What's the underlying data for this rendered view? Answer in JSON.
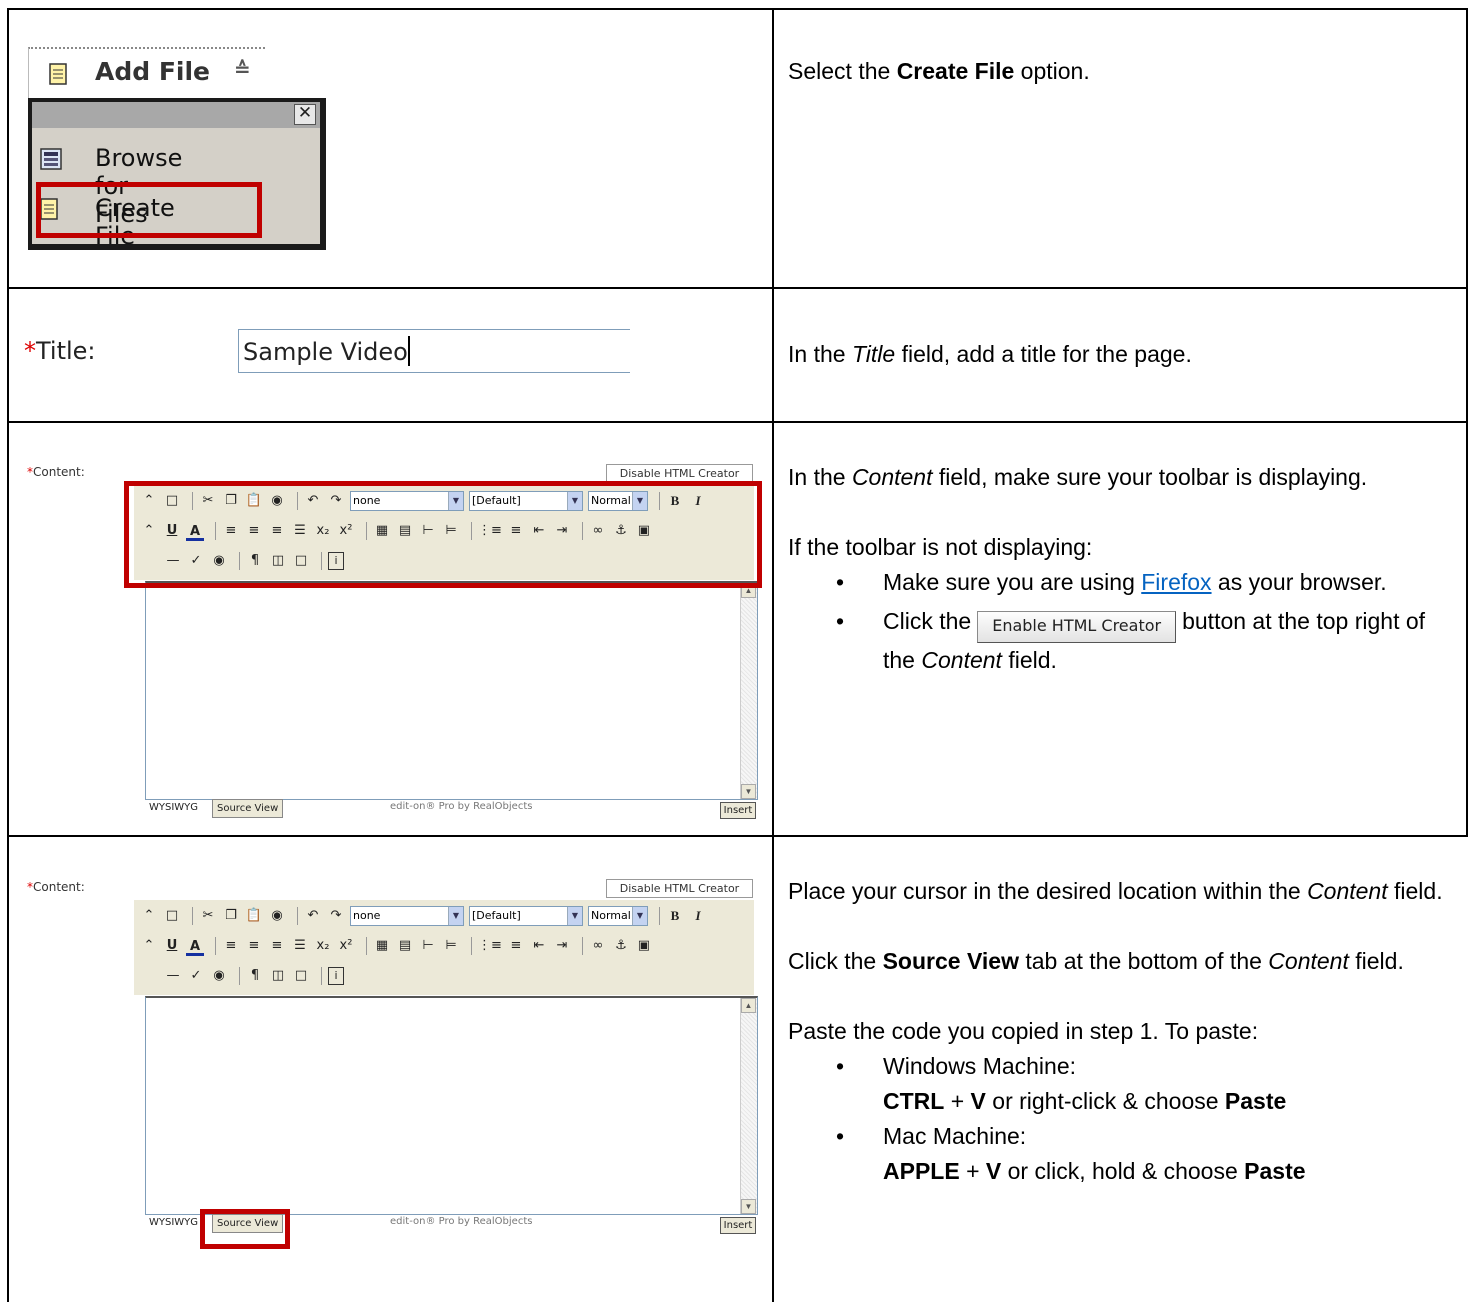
{
  "row1": {
    "addfile_label": "Add File",
    "menu_items": [
      "Browse for Files",
      "Create File"
    ],
    "instruction": {
      "pre": "Select the ",
      "bold": "Create File",
      "post": " option."
    }
  },
  "row2": {
    "required_mark": "*",
    "title_label": "Title:",
    "title_value": "Sample Video",
    "instruction": {
      "pre": "In the ",
      "italic": "Title",
      "post": " field, add a title for the page."
    }
  },
  "editor": {
    "required_mark": "*",
    "content_label": "Content:",
    "disable_button": "Disable HTML Creator",
    "style_select": "none",
    "font_select": "[Default]",
    "size_select": "Normal",
    "tab_wysiwyg": "WYSIWYG",
    "tab_source": "Source View",
    "powered_by": "edit-on® Pro by RealObjects",
    "insert": "Insert"
  },
  "row3": {
    "p1_pre": "In the ",
    "p1_italic": "Content",
    "p1_post": " field, make sure your toolbar is displaying.",
    "p2": "If the toolbar is not displaying:",
    "b1_pre": "Make sure you are using ",
    "b1_link": "Firefox",
    "b1_post": " as your browser.",
    "b2_pre": "Click the",
    "b2_button": "Enable HTML Creator",
    "b2_post": "button at the top right of the ",
    "b2_italic": "Content",
    "b2_end": " field."
  },
  "row4": {
    "p1_pre": "Place your cursor in the desired location within the ",
    "p1_italic": "Content",
    "p1_post": " field.",
    "p2_pre": "Click the ",
    "p2_bold": "Source View",
    "p2_mid": " tab at the bottom of the ",
    "p2_italic": "Content",
    "p2_post": " field.",
    "p3": "Paste the code you copied in step 1.  To paste:",
    "win_label": "Windows Machine:",
    "win_key1": "CTRL",
    "win_plus": " + ",
    "win_key2": "V",
    "win_mid": " or right-click & choose ",
    "win_action": "Paste",
    "mac_label": "Mac Machine:",
    "mac_key1": "APPLE",
    "mac_plus": " + ",
    "mac_key2": "V",
    "mac_mid": " or click, hold & choose ",
    "mac_action": "Paste"
  },
  "colors": {
    "highlight": "#c00000",
    "link": "#0563c1",
    "toolbar_bg": "#ece9d8"
  }
}
